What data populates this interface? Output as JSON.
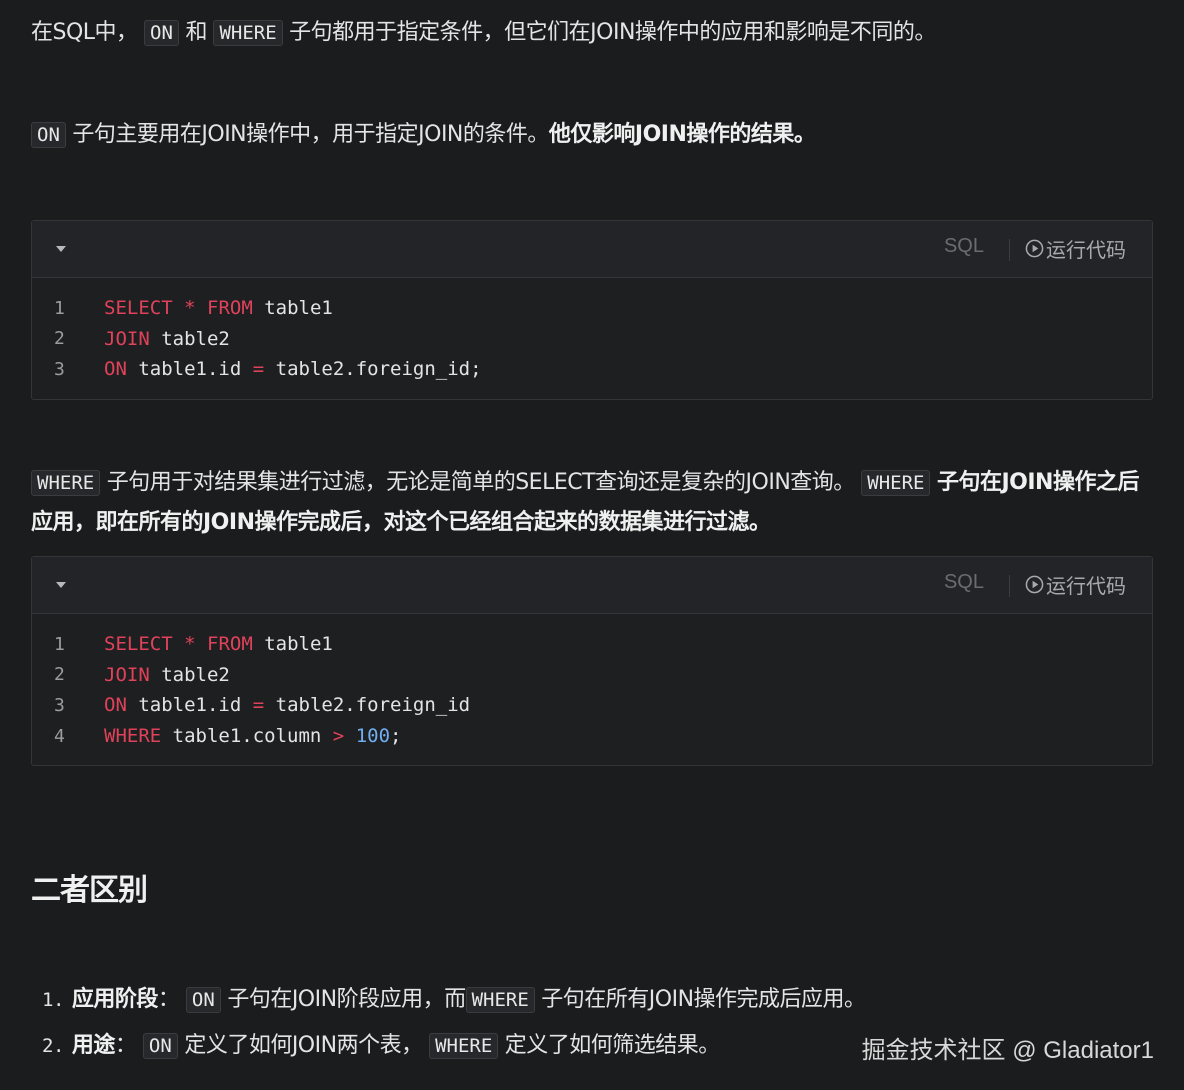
{
  "intro": {
    "p1_a": "在SQL中，",
    "p1_code1": "ON",
    "p1_b": "和",
    "p1_code2": "WHERE",
    "p1_c": "子句都用于指定条件，但它们在JOIN操作中的应用和影响是不同的。"
  },
  "on_para": {
    "code": "ON",
    "text": "子句主要用在JOIN操作中，用于指定JOIN的条件。",
    "bold": "他仅影响JOIN操作的结果。"
  },
  "codeblock1": {
    "lang": "SQL",
    "run_label": "运行代码",
    "lines": [
      {
        "n": "1",
        "t": [
          [
            "kw",
            "SELECT"
          ],
          [
            "id",
            " "
          ],
          [
            "op",
            "*"
          ],
          [
            "id",
            " "
          ],
          [
            "kw",
            "FROM"
          ],
          [
            "id",
            " table1"
          ]
        ]
      },
      {
        "n": "2",
        "t": [
          [
            "kw",
            "JOIN"
          ],
          [
            "id",
            " table2"
          ]
        ]
      },
      {
        "n": "3",
        "t": [
          [
            "kw",
            "ON"
          ],
          [
            "id",
            " table1.id "
          ],
          [
            "op",
            "="
          ],
          [
            "id",
            " table2.foreign_id;"
          ]
        ]
      }
    ]
  },
  "where_para": {
    "code1": "WHERE",
    "text1": "子句用于对结果集进行过滤，无论是简单的SELECT查询还是复杂的JOIN查询。",
    "code2": "WHERE",
    "bold1": "子句在JOIN操作",
    "bold2": "之后应用，即在所有的JOIN操作完成后，对这个已经组合起来的数据集进行过滤。"
  },
  "codeblock2": {
    "lang": "SQL",
    "run_label": "运行代码",
    "lines": [
      {
        "n": "1",
        "t": [
          [
            "kw",
            "SELECT"
          ],
          [
            "id",
            " "
          ],
          [
            "op",
            "*"
          ],
          [
            "id",
            " "
          ],
          [
            "kw",
            "FROM"
          ],
          [
            "id",
            " table1"
          ]
        ]
      },
      {
        "n": "2",
        "t": [
          [
            "kw",
            "JOIN"
          ],
          [
            "id",
            " table2"
          ]
        ]
      },
      {
        "n": "3",
        "t": [
          [
            "kw",
            "ON"
          ],
          [
            "id",
            " table1.id "
          ],
          [
            "op",
            "="
          ],
          [
            "id",
            " table2.foreign_id"
          ]
        ]
      },
      {
        "n": "4",
        "t": [
          [
            "kw",
            "WHERE"
          ],
          [
            "id",
            " table1.column "
          ],
          [
            "op",
            ">"
          ],
          [
            "id",
            " "
          ],
          [
            "num",
            "100"
          ],
          [
            "id",
            ";"
          ]
        ]
      }
    ]
  },
  "section": {
    "heading": "二者区别",
    "items": [
      {
        "num": "1.",
        "label": "应用阶段",
        "colon": "：",
        "code1": "ON",
        "text1": "子句在JOIN阶段应用，而",
        "code2": "WHERE",
        "text2": "子句在所有JOIN操作完成后应用。"
      },
      {
        "num": "2.",
        "label": "用途",
        "colon": "：",
        "code1": "ON",
        "text1": "定义了如何JOIN两个表，",
        "code2": "WHERE",
        "text2": "定义了如何筛选结果。"
      }
    ]
  },
  "watermark": "掘金技术社区 @ Gladiator1",
  "colors": {
    "background": "#1b1c1d",
    "keyword": "#e0425a",
    "number": "#71aef0"
  }
}
